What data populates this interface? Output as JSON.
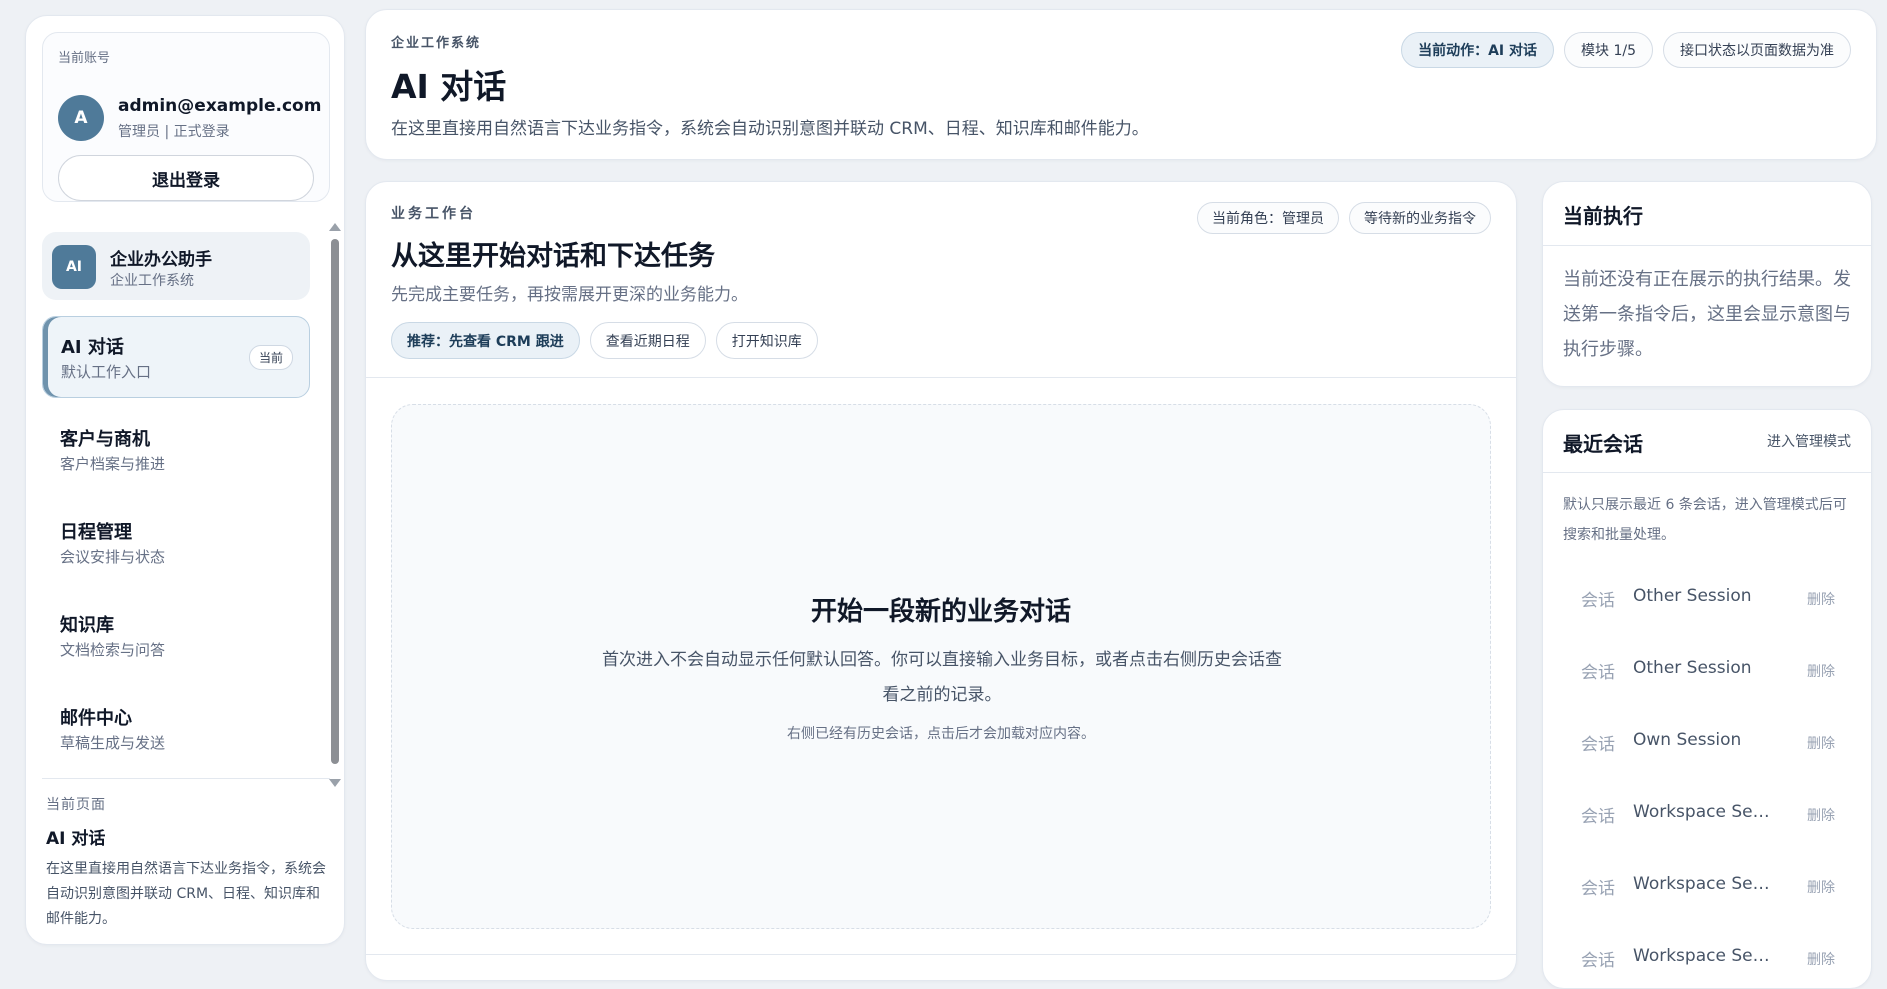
{
  "account": {
    "label": "当前账号",
    "avatar_letter": "A",
    "email": "admin@example.com",
    "role": "管理员 | 正式登录",
    "logout_label": "退出登录"
  },
  "brand": {
    "logo": "AI",
    "name": "企业办公助手",
    "subtitle": "企业工作系统"
  },
  "nav": {
    "items": [
      {
        "title": "AI 对话",
        "desc": "默认工作入口",
        "badge": "当前",
        "active": true
      },
      {
        "title": "客户与商机",
        "desc": "客户档案与推进"
      },
      {
        "title": "日程管理",
        "desc": "会议安排与状态"
      },
      {
        "title": "知识库",
        "desc": "文档检索与问答"
      },
      {
        "title": "邮件中心",
        "desc": "草稿生成与发送"
      }
    ]
  },
  "current_page": {
    "label": "当前页面",
    "title": "AI 对话",
    "desc": "在这里直接用自然语言下达业务指令，系统会自动识别意图并联动 CRM、日程、知识库和邮件能力。"
  },
  "header": {
    "eyebrow": "企业工作系统",
    "title": "AI 对话",
    "desc": "在这里直接用自然语言下达业务指令，系统会自动识别意图并联动 CRM、日程、知识库和邮件能力。",
    "chips": [
      "当前动作：AI 对话",
      "模块 1/5",
      "接口状态以页面数据为准"
    ]
  },
  "workspace": {
    "eyebrow": "业务工作台",
    "title": "从这里开始对话和下达任务",
    "desc": "先完成主要任务，再按需展开更深的业务能力。",
    "chips": [
      "当前角色：管理员",
      "等待新的业务指令"
    ],
    "actions": [
      "推荐：先查看 CRM 跟进",
      "查看近期日程",
      "打开知识库"
    ],
    "empty_title": "开始一段新的业务对话",
    "empty_desc": "首次进入不会自动显示任何默认回答。你可以直接输入业务目标，或者点击右侧历史会话查看之前的记录。",
    "empty_note": "右侧已经有历史会话，点击后才会加载对应内容。"
  },
  "execution": {
    "title": "当前执行",
    "desc": "当前还没有正在展示的执行结果。发送第一条指令后，这里会显示意图与执行步骤。"
  },
  "sessions": {
    "title": "最近会话",
    "manage_label": "进入管理模式",
    "desc": "默认只展示最近 6 条会话，进入管理模式后可搜索和批量处理。",
    "items": [
      {
        "kind": "会话",
        "name": "Other Session",
        "delete": "删除"
      },
      {
        "kind": "会话",
        "name": "Other Session",
        "delete": "删除"
      },
      {
        "kind": "会话",
        "name": "Own Session",
        "delete": "删除"
      },
      {
        "kind": "会话",
        "name": "Workspace Session",
        "delete": "删除"
      },
      {
        "kind": "会话",
        "name": "Workspace Session",
        "delete": "删除"
      },
      {
        "kind": "会话",
        "name": "Workspace Session",
        "delete": "删除"
      }
    ]
  },
  "colors": {
    "accent": "#4f7a99",
    "background": "#eef1f5",
    "text": "#101828",
    "muted": "#667085"
  }
}
